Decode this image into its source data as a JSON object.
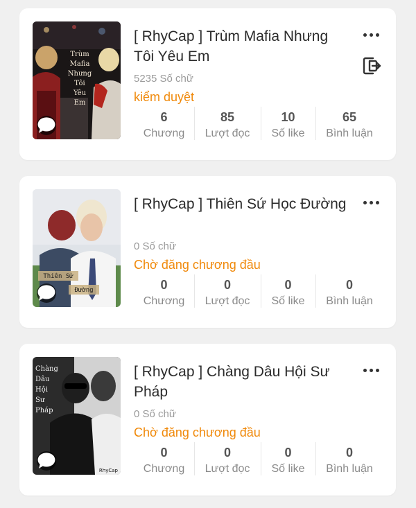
{
  "stories": [
    {
      "title": "[ RhyCap ] Trùm Mafia Nhưng Tôi Yêu Em",
      "words": "5235 Số chữ",
      "status": "kiểm duyệt",
      "cover_text": [
        "Trùm",
        "Mafia",
        "Nhưng",
        "Tôi",
        "Yêu",
        "Em"
      ],
      "stats": [
        {
          "value": "6",
          "label": "Chương"
        },
        {
          "value": "85",
          "label": "Lượt đọc"
        },
        {
          "value": "10",
          "label": "Số like"
        },
        {
          "value": "65",
          "label": "Bình luận"
        }
      ]
    },
    {
      "title": "[ RhyCap ] Thiên Sứ Học Đường",
      "words": "0 Số chữ",
      "status": "Chờ đăng chương đầu",
      "cover_text": [
        "Thiên Sứ",
        "Đường"
      ],
      "stats": [
        {
          "value": "0",
          "label": "Chương"
        },
        {
          "value": "0",
          "label": "Lượt đọc"
        },
        {
          "value": "0",
          "label": "Số like"
        },
        {
          "value": "0",
          "label": "Bình luận"
        }
      ]
    },
    {
      "title": "[ RhyCap ] Chàng Dâu Hội Sư Pháp",
      "words": "0 Số chữ",
      "status": "Chờ đăng chương đầu",
      "cover_text": [
        "Chàng",
        "Dâu",
        "Hội",
        "Sư",
        "Pháp"
      ],
      "cover_signature": "RhyCap",
      "stats": [
        {
          "value": "0",
          "label": "Chương"
        },
        {
          "value": "0",
          "label": "Lượt đọc"
        },
        {
          "value": "0",
          "label": "Số like"
        },
        {
          "value": "0",
          "label": "Bình luận"
        }
      ]
    }
  ],
  "icons": {
    "more": "more-options-icon",
    "exit": "exit-icon",
    "comment": "comment-bubble-icon"
  },
  "colors": {
    "status": "#f0890a",
    "background": "#f0f0f0",
    "card": "#ffffff"
  }
}
